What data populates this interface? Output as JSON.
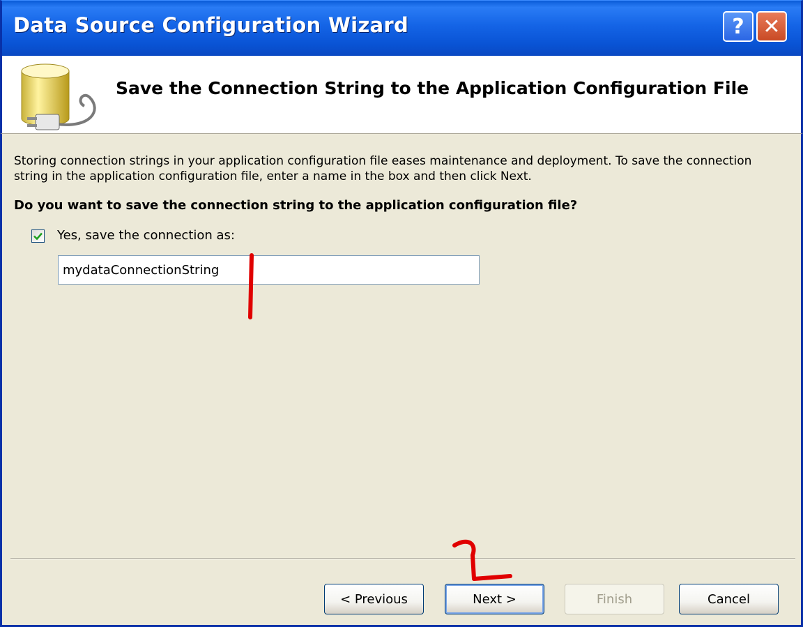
{
  "window": {
    "title": "Data Source Configuration Wizard",
    "help_label": "?",
    "close_label": "✕"
  },
  "header": {
    "title": "Save the Connection String to the Application Configuration File",
    "icon": "database-plug-icon"
  },
  "content": {
    "description": "Storing connection strings in your application configuration file eases maintenance and deployment. To save the connection string in the application configuration file, enter a name in the box and then click Next.",
    "question": "Do you want to save the connection string to the application configuration file?",
    "checkbox_label": "Yes, save the connection as:",
    "checkbox_checked": true,
    "connection_name": "mydataConnectionString"
  },
  "buttons": {
    "previous": "< Previous",
    "next": "Next >",
    "finish": "Finish",
    "cancel": "Cancel"
  },
  "colors": {
    "titlebar": "#0a5cd8",
    "dialog_bg": "#ece9d8",
    "annotation": "#e00000"
  }
}
